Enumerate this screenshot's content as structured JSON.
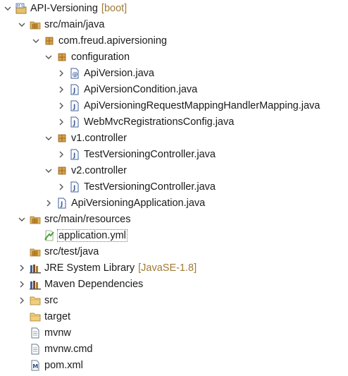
{
  "tree": {
    "rows": [
      {
        "label": "API-Versioning",
        "deco": "[boot]"
      },
      {
        "label": "src/main/java"
      },
      {
        "label": "com.freud.apiversioning"
      },
      {
        "label": "configuration"
      },
      {
        "label": "ApiVersion.java"
      },
      {
        "label": "ApiVersionCondition.java"
      },
      {
        "label": "ApiVersioningRequestMappingHandlerMapping.java"
      },
      {
        "label": "WebMvcRegistrationsConfig.java"
      },
      {
        "label": "v1.controller"
      },
      {
        "label": "TestVersioningController.java"
      },
      {
        "label": "v2.controller"
      },
      {
        "label": "TestVersioningController.java"
      },
      {
        "label": "ApiVersioningApplication.java"
      },
      {
        "label": "src/main/resources"
      },
      {
        "label": "application.yml"
      },
      {
        "label": "src/test/java"
      },
      {
        "label": "JRE System Library",
        "deco": "[JavaSE-1.8]"
      },
      {
        "label": "Maven Dependencies"
      },
      {
        "label": "src"
      },
      {
        "label": "target"
      },
      {
        "label": "mvnw"
      },
      {
        "label": "mvnw.cmd"
      },
      {
        "label": "pom.xml"
      }
    ]
  },
  "colors": {
    "decoration": "#a07a35",
    "twisty": "#555555",
    "package": "#b07c2c",
    "folder": "#e0b55a",
    "java_file_border": "#3f5f9a",
    "yml": "#4aa43a"
  }
}
